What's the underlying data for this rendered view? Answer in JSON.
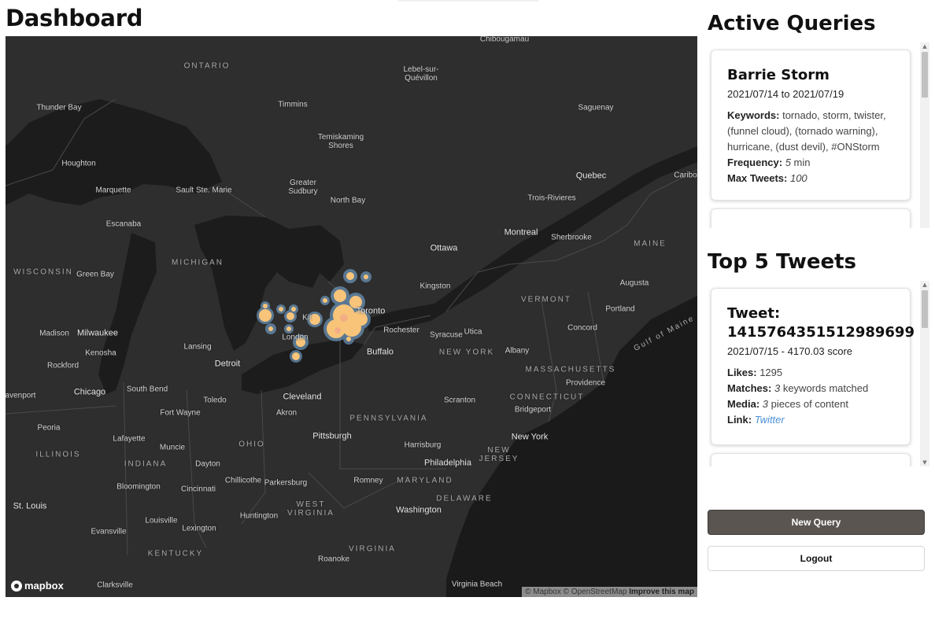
{
  "page": {
    "title": "Dashboard"
  },
  "map": {
    "labels": [
      {
        "text": "Chibougamau",
        "cls": "",
        "name": "map-label-chibougamau"
      },
      {
        "text": "ONTARIO",
        "cls": "region",
        "name": "map-label-ontario"
      },
      {
        "text": "Lebel-sur-\nQuévillon",
        "cls": "",
        "name": "map-label-lebel-sur-quevillon"
      },
      {
        "text": "Thunder Bay",
        "cls": "",
        "name": "map-label-thunder-bay"
      },
      {
        "text": "Timmins",
        "cls": "",
        "name": "map-label-timmins"
      },
      {
        "text": "Saguenay",
        "cls": "",
        "name": "map-label-saguenay"
      },
      {
        "text": "Temiskaming\nShores",
        "cls": "",
        "name": "map-label-temiskaming-shores"
      },
      {
        "text": "Houghton",
        "cls": "",
        "name": "map-label-houghton"
      },
      {
        "text": "Quebec",
        "cls": "city-big",
        "name": "map-label-quebec"
      },
      {
        "text": "Caribo",
        "cls": "",
        "name": "map-label-caribou"
      },
      {
        "text": "Greater\nSudbury",
        "cls": "",
        "name": "map-label-greater-sudbury"
      },
      {
        "text": "Marquette",
        "cls": "",
        "name": "map-label-marquette"
      },
      {
        "text": "Sault Ste. Marie",
        "cls": "",
        "name": "map-label-sault-ste-marie"
      },
      {
        "text": "North Bay",
        "cls": "",
        "name": "map-label-north-bay"
      },
      {
        "text": "Trois-Rivieres",
        "cls": "",
        "name": "map-label-trois-rivieres"
      },
      {
        "text": "Escanaba",
        "cls": "",
        "name": "map-label-escanaba"
      },
      {
        "text": "Montreal",
        "cls": "city-big",
        "name": "map-label-montreal"
      },
      {
        "text": "Sherbrooke",
        "cls": "",
        "name": "map-label-sherbrooke"
      },
      {
        "text": "Ottawa",
        "cls": "city-big",
        "name": "map-label-ottawa"
      },
      {
        "text": "MAINE",
        "cls": "region",
        "name": "map-label-maine"
      },
      {
        "text": "MICHIGAN",
        "cls": "region",
        "name": "map-label-michigan"
      },
      {
        "text": "WISCONSIN",
        "cls": "region",
        "name": "map-label-wisconsin"
      },
      {
        "text": "Green Bay",
        "cls": "",
        "name": "map-label-green-bay"
      },
      {
        "text": "Kingston",
        "cls": "",
        "name": "map-label-kingston"
      },
      {
        "text": "Augusta",
        "cls": "",
        "name": "map-label-augusta"
      },
      {
        "text": "VERMONT",
        "cls": "region",
        "name": "map-label-vermont"
      },
      {
        "text": "Toronto",
        "cls": "city-big",
        "name": "map-label-toronto"
      },
      {
        "text": "Portland",
        "cls": "",
        "name": "map-label-portland"
      },
      {
        "text": "Kit",
        "cls": "",
        "name": "map-label-kitchener"
      },
      {
        "text": "Madison",
        "cls": "",
        "name": "map-label-madison"
      },
      {
        "text": "Milwaukee",
        "cls": "city-big",
        "name": "map-label-milwaukee"
      },
      {
        "text": "Rochester",
        "cls": "",
        "name": "map-label-rochester"
      },
      {
        "text": "Syracuse",
        "cls": "",
        "name": "map-label-syracuse"
      },
      {
        "text": "Utica",
        "cls": "",
        "name": "map-label-utica"
      },
      {
        "text": "Concord",
        "cls": "",
        "name": "map-label-concord"
      },
      {
        "text": "London",
        "cls": "",
        "name": "map-label-london"
      },
      {
        "text": "Lansing",
        "cls": "",
        "name": "map-label-lansing"
      },
      {
        "text": "Gulf of Maine",
        "cls": "region",
        "name": "map-label-gulf-of-maine"
      },
      {
        "text": "Kenosha",
        "cls": "",
        "name": "map-label-kenosha"
      },
      {
        "text": "Buffalo",
        "cls": "city-big",
        "name": "map-label-buffalo"
      },
      {
        "text": "NEW YORK",
        "cls": "region",
        "name": "map-label-new-york-state"
      },
      {
        "text": "Albany",
        "cls": "",
        "name": "map-label-albany"
      },
      {
        "text": "Detroit",
        "cls": "city-big",
        "name": "map-label-detroit"
      },
      {
        "text": "Rockford",
        "cls": "",
        "name": "map-label-rockford"
      },
      {
        "text": "MASSACHUSETTS",
        "cls": "region",
        "name": "map-label-massachusetts"
      },
      {
        "text": "Providence",
        "cls": "",
        "name": "map-label-providence"
      },
      {
        "text": "Chicago",
        "cls": "city-big",
        "name": "map-label-chicago"
      },
      {
        "text": "South Bend",
        "cls": "",
        "name": "map-label-south-bend"
      },
      {
        "text": "Toledo",
        "cls": "",
        "name": "map-label-toledo"
      },
      {
        "text": "Cleveland",
        "cls": "city-big",
        "name": "map-label-cleveland"
      },
      {
        "text": "Scranton",
        "cls": "",
        "name": "map-label-scranton"
      },
      {
        "text": "CONNECTICUT",
        "cls": "region",
        "name": "map-label-connecticut"
      },
      {
        "text": "avenport",
        "cls": "",
        "name": "map-label-davenport"
      },
      {
        "text": "Bridgeport",
        "cls": "",
        "name": "map-label-bridgeport"
      },
      {
        "text": "Fort Wayne",
        "cls": "",
        "name": "map-label-fort-wayne"
      },
      {
        "text": "Akron",
        "cls": "",
        "name": "map-label-akron"
      },
      {
        "text": "PENNSYLVANIA",
        "cls": "region",
        "name": "map-label-pennsylvania"
      },
      {
        "text": "Peoria",
        "cls": "",
        "name": "map-label-peoria"
      },
      {
        "text": "Pittsburgh",
        "cls": "city-big",
        "name": "map-label-pittsburgh"
      },
      {
        "text": "New York",
        "cls": "city-big",
        "name": "map-label-new-york-city"
      },
      {
        "text": "Lafayette",
        "cls": "",
        "name": "map-label-lafayette"
      },
      {
        "text": "Muncie",
        "cls": "",
        "name": "map-label-muncie"
      },
      {
        "text": "OHIO",
        "cls": "region",
        "name": "map-label-ohio"
      },
      {
        "text": "Harrisburg",
        "cls": "",
        "name": "map-label-harrisburg"
      },
      {
        "text": "NEW\nJERSEY",
        "cls": "region",
        "name": "map-label-new-jersey"
      },
      {
        "text": "ILLINOIS",
        "cls": "region",
        "name": "map-label-illinois"
      },
      {
        "text": "INDIANA",
        "cls": "region",
        "name": "map-label-indiana"
      },
      {
        "text": "Dayton",
        "cls": "",
        "name": "map-label-dayton"
      },
      {
        "text": "Philadelphia",
        "cls": "city-big",
        "name": "map-label-philadelphia"
      },
      {
        "text": "Chillicothe",
        "cls": "",
        "name": "map-label-chillicothe"
      },
      {
        "text": "Parkersburg",
        "cls": "",
        "name": "map-label-parkersburg"
      },
      {
        "text": "Romney",
        "cls": "",
        "name": "map-label-romney"
      },
      {
        "text": "MARYLAND",
        "cls": "region",
        "name": "map-label-maryland"
      },
      {
        "text": "Bloomington",
        "cls": "",
        "name": "map-label-bloomington"
      },
      {
        "text": "Cincinnati",
        "cls": "",
        "name": "map-label-cincinnati"
      },
      {
        "text": "DELAWARE",
        "cls": "region",
        "name": "map-label-delaware"
      },
      {
        "text": "WEST\nVIRGINIA",
        "cls": "region",
        "name": "map-label-west-virginia"
      },
      {
        "text": "Washington",
        "cls": "city-big",
        "name": "map-label-washington"
      },
      {
        "text": "St. Louis",
        "cls": "city-big",
        "name": "map-label-st-louis"
      },
      {
        "text": "Huntington",
        "cls": "",
        "name": "map-label-huntington"
      },
      {
        "text": "Louisville",
        "cls": "",
        "name": "map-label-louisville"
      },
      {
        "text": "Evansville",
        "cls": "",
        "name": "map-label-evansville"
      },
      {
        "text": "Lexington",
        "cls": "",
        "name": "map-label-lexington"
      },
      {
        "text": "VIRGINIA",
        "cls": "region",
        "name": "map-label-virginia"
      },
      {
        "text": "KENTUCKY",
        "cls": "region",
        "name": "map-label-kentucky"
      },
      {
        "text": "Roanoke",
        "cls": "",
        "name": "map-label-roanoke"
      },
      {
        "text": "Clarksville",
        "cls": "",
        "name": "map-label-clarksville"
      },
      {
        "text": "Virginia Beach",
        "cls": "",
        "name": "map-label-virginia-beach"
      }
    ],
    "logo_text": "mapbox",
    "attribution": {
      "mapbox": "© Mapbox",
      "osm": "© OpenStreetMap",
      "improve": "Improve this map"
    }
  },
  "active_queries": {
    "title": "Active Queries",
    "card": {
      "title": "Barrie Storm",
      "date_range": "2021/07/14 to 2021/07/19",
      "keywords_label": "Keywords:",
      "keywords_value": " tornado, storm, twister, (funnel cloud), (tornado warning), hurricane, (dust devil), #ONStorm",
      "frequency_label": "Frequency:",
      "frequency_value": "5",
      "frequency_unit": " min",
      "max_tweets_label": "Max Tweets:",
      "max_tweets_value": "100"
    }
  },
  "top_tweets": {
    "title": "Top 5 Tweets",
    "card": {
      "title_line1": "Tweet:",
      "title_line2": "1415764351512989699",
      "subtitle": "2021/07/15 - 4170.03 score",
      "likes_label": "Likes:",
      "likes_value": " 1295",
      "matches_label": "Matches:",
      "matches_value": "3",
      "matches_suffix": " keywords matched",
      "media_label": "Media:",
      "media_value": "3",
      "media_suffix": " pieces of content",
      "link_label": "Link:",
      "link_text": "Twitter"
    }
  },
  "buttons": {
    "new_query": "New Query",
    "logout": "Logout"
  },
  "colors": {
    "map_bg": "#2b2b2b",
    "water": "#1b1b1b",
    "heat_core": "#f7c47a",
    "heat_glow": "#7fb6e6",
    "primary_button": "#5a5551",
    "link": "#4a90d9"
  }
}
